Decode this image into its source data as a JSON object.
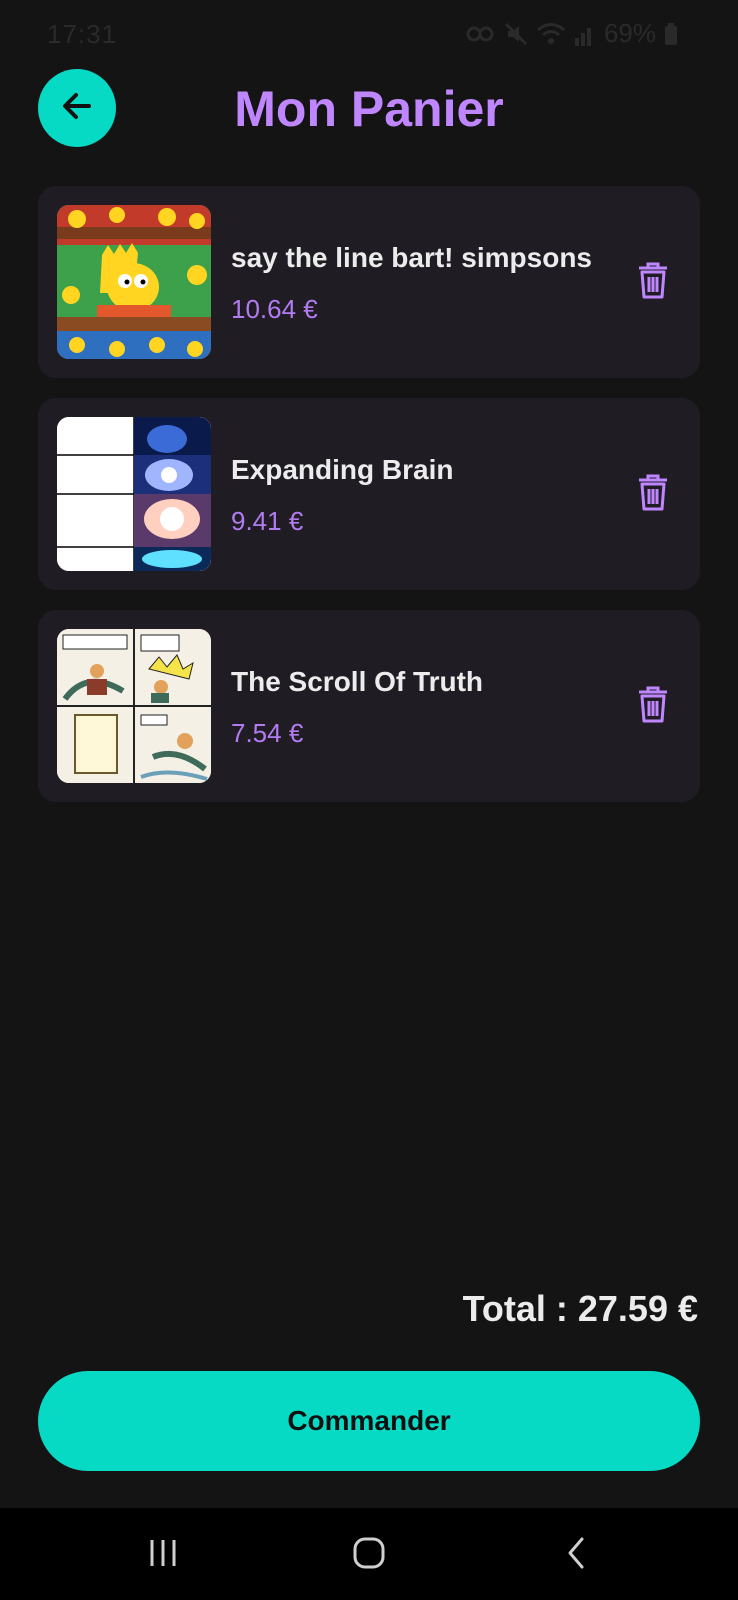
{
  "status_bar": {
    "time": "17:31",
    "battery": "69%",
    "icons": [
      "key-icon",
      "mute-icon",
      "wifi-icon",
      "signal-icon",
      "battery-icon"
    ]
  },
  "header": {
    "title": "Mon Panier",
    "back_icon": "arrow-left-icon"
  },
  "cart": {
    "items": [
      {
        "title": "say the line bart! simpsons",
        "price": "10.64 €",
        "image": "bart-simpson-meme"
      },
      {
        "title": "Expanding Brain",
        "price": "9.41 €",
        "image": "expanding-brain-meme"
      },
      {
        "title": "The Scroll Of Truth",
        "price": "7.54 €",
        "image": "scroll-of-truth-meme"
      }
    ],
    "delete_icon": "trash-icon"
  },
  "total": "Total : 27.59 €",
  "order_button": "Commander",
  "colors": {
    "accent": "#06d9c4",
    "title": "#c086ff",
    "price": "#b27cf0",
    "background": "#141414",
    "card": "#1f1c24"
  },
  "nav": [
    "recent-apps-icon",
    "home-icon",
    "back-icon"
  ]
}
